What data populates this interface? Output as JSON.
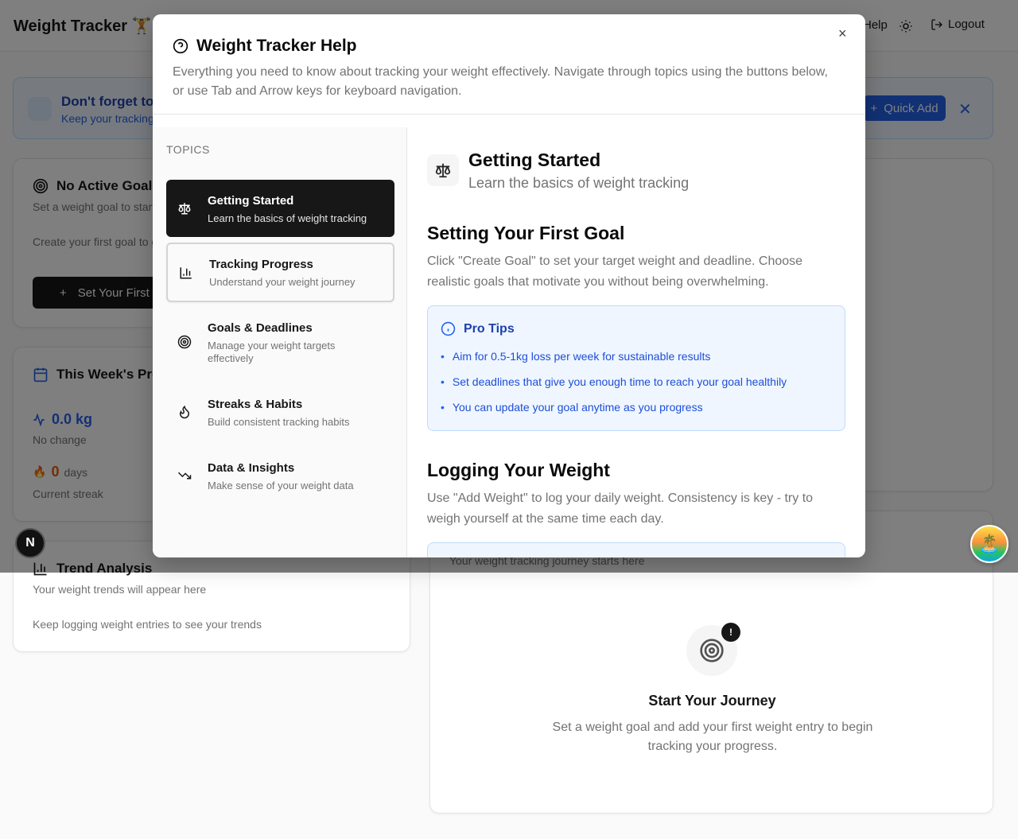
{
  "app": {
    "title": "Weight Tracker 🏋️",
    "help_label": "Help",
    "logout_label": "Logout"
  },
  "banner": {
    "title": "Don't forget to log your weight today!",
    "subtitle": "Keep your tracking streak going",
    "quick_add_label": "Quick Add",
    "close_symbol": "✕"
  },
  "goal_card": {
    "title": "No Active Goal",
    "subtitle": "Set a weight goal to start tracking progress",
    "body": "Create your first goal to get started",
    "button_label": "Set Your First Goal"
  },
  "week_card": {
    "title": "This Week's Progress",
    "change_value": "0.0 kg",
    "change_label": "No change",
    "streak_value": "0",
    "streak_unit": "days",
    "streak_label": "Current streak"
  },
  "trend_card": {
    "title": "Trend Analysis",
    "subtitle": "Your weight trends will appear here",
    "body": "Keep logging weight entries to see your trends"
  },
  "journey_card": {
    "subtitle": "Your weight tracking journey starts here",
    "badge": "!",
    "title": "Start Your Journey",
    "description": "Set a weight goal and add your first weight entry to begin tracking your progress."
  },
  "floating": {
    "n_badge": "N",
    "avatar_emoji": "🏝️"
  },
  "modal": {
    "title": "Weight Tracker Help",
    "description": "Everything you need to know about tracking your weight effectively. Navigate through topics using the buttons below, or use Tab and Arrow keys for keyboard navigation.",
    "close_symbol": "×",
    "topics_label": "TOPICS",
    "topics": [
      {
        "name": "Getting Started",
        "desc": "Learn the basics of weight tracking",
        "icon": "scale-icon"
      },
      {
        "name": "Tracking Progress",
        "desc": "Understand your weight journey",
        "icon": "bar-chart-icon"
      },
      {
        "name": "Goals & Deadlines",
        "desc": "Manage your weight targets effectively",
        "icon": "target-icon"
      },
      {
        "name": "Streaks & Habits",
        "desc": "Build consistent tracking habits",
        "icon": "flame-icon"
      },
      {
        "name": "Data & Insights",
        "desc": "Make sense of your weight data",
        "icon": "trending-down-icon"
      }
    ],
    "content": {
      "title": "Getting Started",
      "subtitle": "Learn the basics of weight tracking",
      "section1_title": "Setting Your First Goal",
      "section1_text": "Click \"Create Goal\" to set your target weight and deadline. Choose realistic goals that motivate you without being overwhelming.",
      "tips_title": "Pro Tips",
      "tips": [
        "Aim for 0.5-1kg loss per week for sustainable results",
        "Set deadlines that give you enough time to reach your goal healthily",
        "You can update your goal anytime as you progress"
      ],
      "section2_title": "Logging Your Weight",
      "section2_text": "Use \"Add Weight\" to log your daily weight. Consistency is key - try to weigh yourself at the same time each day."
    }
  },
  "colors": {
    "accent": "#2563eb",
    "dark": "#171717",
    "tip_bg": "#eff6ff",
    "streak": "#ea580c"
  }
}
